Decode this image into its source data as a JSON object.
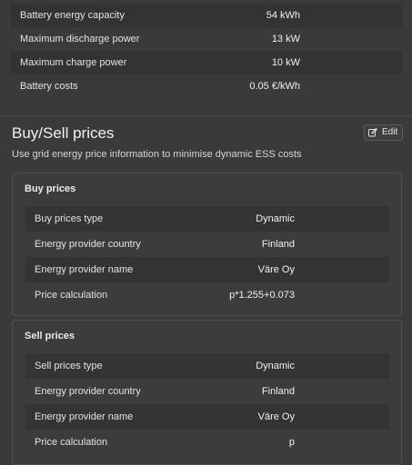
{
  "battery": {
    "rows": [
      {
        "label": "Battery energy capacity",
        "value": "54 kWh"
      },
      {
        "label": "Maximum discharge power",
        "value": "13 kW"
      },
      {
        "label": "Maximum charge power",
        "value": "10 kW"
      },
      {
        "label": "Battery costs",
        "value": "0.05 €/kWh"
      }
    ]
  },
  "buy_sell": {
    "title": "Buy/Sell prices",
    "description": "Use grid energy price information to minimise dynamic ESS costs",
    "edit_label": "Edit",
    "buy": {
      "header": "Buy prices",
      "rows": [
        {
          "label": "Buy prices type",
          "value": "Dynamic"
        },
        {
          "label": "Energy provider country",
          "value": "Finland"
        },
        {
          "label": "Energy provider name",
          "value": "Väre Oy"
        },
        {
          "label": "Price calculation",
          "value": "p*1.255+0.073"
        }
      ]
    },
    "sell": {
      "header": "Sell prices",
      "rows": [
        {
          "label": "Sell prices type",
          "value": "Dynamic"
        },
        {
          "label": "Energy provider country",
          "value": "Finland"
        },
        {
          "label": "Energy provider name",
          "value": "Väre Oy"
        },
        {
          "label": "Price calculation",
          "value": "p"
        }
      ]
    }
  },
  "colors": {
    "background": "#3a3a3a",
    "row_stripe": "#333333",
    "card_border": "#505050"
  }
}
